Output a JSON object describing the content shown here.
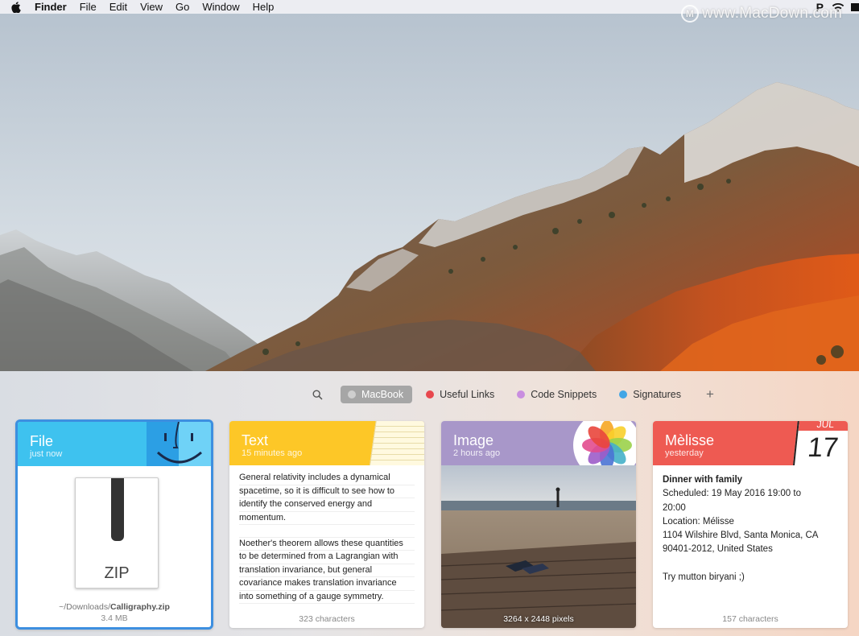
{
  "menubar": {
    "items": [
      "Finder",
      "File",
      "Edit",
      "View",
      "Go",
      "Window",
      "Help"
    ]
  },
  "watermark": "www.MacDown.com",
  "shelf": {
    "tabs": [
      {
        "label": "MacBook",
        "color": "#c4c4c4",
        "active": true
      },
      {
        "label": "Useful Links",
        "color": "#e8484e"
      },
      {
        "label": "Code Snippets",
        "color": "#c98ee0"
      },
      {
        "label": "Signatures",
        "color": "#42a6e6"
      }
    ]
  },
  "cards": {
    "file": {
      "title": "File",
      "subtitle": "just now",
      "icon_label": "ZIP",
      "path_prefix": "~/Downloads/",
      "filename": "Calligraphy.zip",
      "size": "3.4 MB"
    },
    "text": {
      "title": "Text",
      "subtitle": "15 minutes ago",
      "paragraph1": [
        "General relativity includes a dynamical",
        "spacetime, so it is difficult to see how to",
        "identify the conserved energy and",
        "momentum."
      ],
      "paragraph2": [
        "Noether's theorem allows these quantities",
        "to be determined from a Lagrangian with",
        "translation invariance, but general",
        "covariance makes translation invariance",
        "into something of a gauge symmetry."
      ],
      "footer": "323 characters"
    },
    "image": {
      "title": "Image",
      "subtitle": "2 hours ago",
      "footer": "3264 x 2448 pixels"
    },
    "contact": {
      "title": "Mèlisse",
      "subtitle": "yesterday",
      "calendar_month": "JUL",
      "calendar_day": "17",
      "event_title": "Dinner with family",
      "lines": [
        "Scheduled: 19 May 2016 19:00 to",
        "20:00",
        "Location: Mélisse",
        "1104 Wilshire Blvd, Santa Monica, CA",
        "90401-2012, United States"
      ],
      "note": "Try mutton biryani ;)",
      "footer": "157 characters"
    }
  }
}
